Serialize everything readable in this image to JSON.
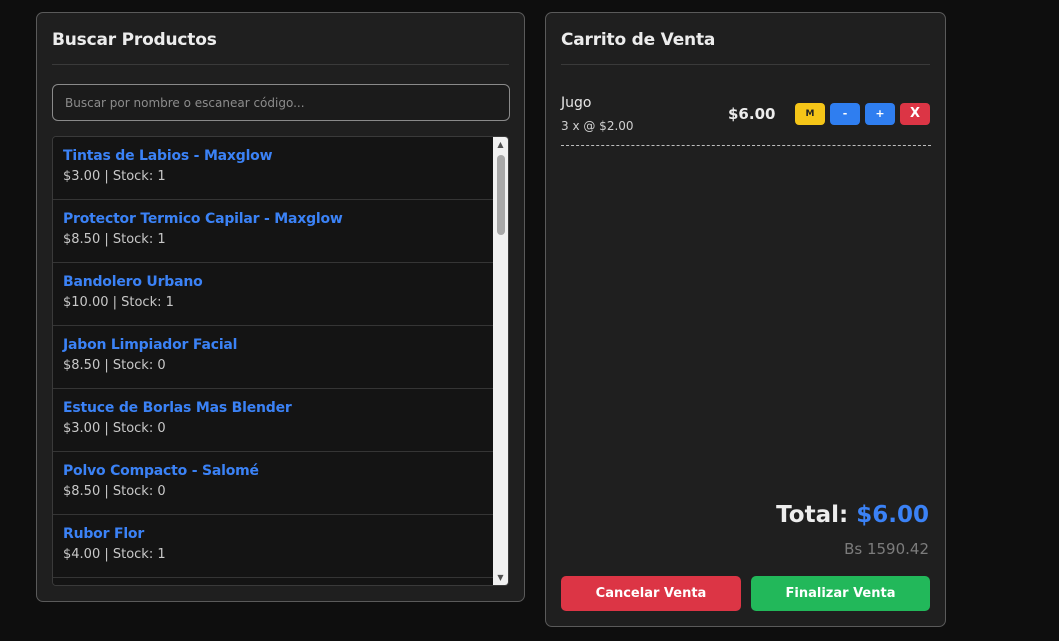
{
  "search_panel": {
    "title": "Buscar Productos",
    "search_placeholder": "Buscar por nombre o escanear código...",
    "search_value": "",
    "products": [
      {
        "name": "Tintas de Labios - Maxglow",
        "meta": "$3.00 | Stock: 1"
      },
      {
        "name": "Protector Termico Capilar - Maxglow",
        "meta": "$8.50 | Stock: 1"
      },
      {
        "name": "Bandolero Urbano",
        "meta": "$10.00 | Stock: 1"
      },
      {
        "name": "Jabon Limpiador Facial",
        "meta": "$8.50 | Stock: 0"
      },
      {
        "name": "Estuce de Borlas Mas Blender",
        "meta": "$3.00 | Stock: 0"
      },
      {
        "name": "Polvo Compacto - Salomé",
        "meta": "$8.50 | Stock: 0"
      },
      {
        "name": "Rubor Flor",
        "meta": "$4.00 | Stock: 1"
      },
      {
        "name": "",
        "meta": ""
      }
    ]
  },
  "cart_panel": {
    "title": "Carrito de Venta",
    "items": [
      {
        "name": "Jugo",
        "detail": "3 x @ $2.00",
        "subtotal": "$6.00",
        "btn_m": "M",
        "btn_minus": "-",
        "btn_plus": "+",
        "btn_remove": "X"
      }
    ],
    "total_label": "Total:",
    "total_amount": "$6.00",
    "total_bs": "Bs 1590.42",
    "cancel_label": "Cancelar Venta",
    "finish_label": "Finalizar Venta"
  },
  "colors": {
    "accent_blue": "#3b82f6",
    "cancel_red": "#dc3545",
    "finish_green": "#22b85a",
    "m_yellow": "#f5c518"
  },
  "icons": {
    "scroll_up": "scroll-up-arrow-icon",
    "scroll_down": "scroll-down-arrow-icon"
  }
}
